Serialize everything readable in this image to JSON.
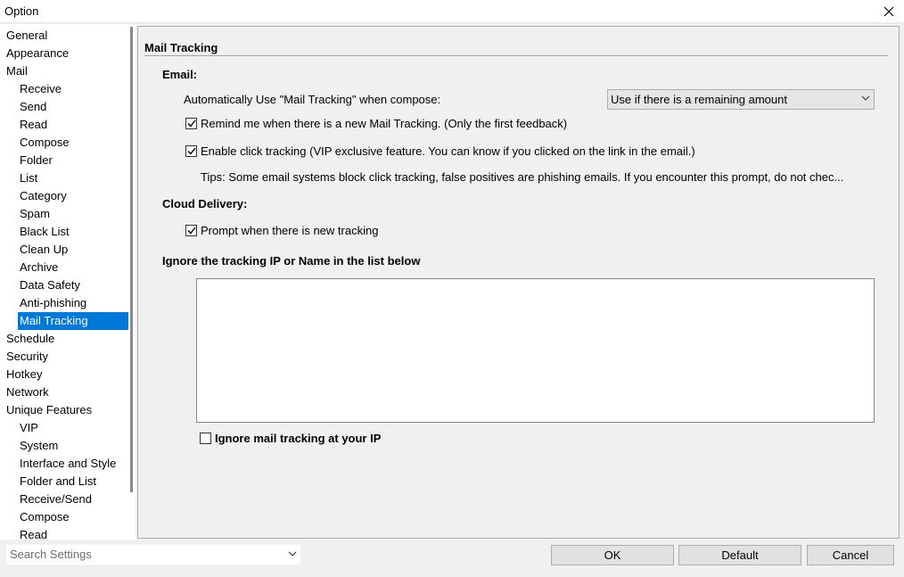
{
  "window": {
    "title": "Option"
  },
  "sidebar": {
    "items": [
      {
        "label": "General",
        "child": false
      },
      {
        "label": "Appearance",
        "child": false
      },
      {
        "label": "Mail",
        "child": false
      },
      {
        "label": "Receive",
        "child": true
      },
      {
        "label": "Send",
        "child": true
      },
      {
        "label": "Read",
        "child": true
      },
      {
        "label": "Compose",
        "child": true
      },
      {
        "label": "Folder",
        "child": true
      },
      {
        "label": "List",
        "child": true
      },
      {
        "label": "Category",
        "child": true
      },
      {
        "label": "Spam",
        "child": true
      },
      {
        "label": "Black List",
        "child": true
      },
      {
        "label": "Clean Up",
        "child": true
      },
      {
        "label": "Archive",
        "child": true
      },
      {
        "label": "Data Safety",
        "child": true
      },
      {
        "label": "Anti-phishing",
        "child": true
      },
      {
        "label": "Mail Tracking",
        "child": true,
        "selected": true
      },
      {
        "label": "Schedule",
        "child": false
      },
      {
        "label": "Security",
        "child": false
      },
      {
        "label": "Hotkey",
        "child": false
      },
      {
        "label": "Network",
        "child": false
      },
      {
        "label": "Unique Features",
        "child": false
      },
      {
        "label": "VIP",
        "child": true
      },
      {
        "label": "System",
        "child": true
      },
      {
        "label": "Interface and Style",
        "child": true
      },
      {
        "label": "Folder and List",
        "child": true
      },
      {
        "label": "Receive/Send",
        "child": true
      },
      {
        "label": "Compose",
        "child": true
      },
      {
        "label": "Read",
        "child": true
      }
    ]
  },
  "main": {
    "section_title": "Mail Tracking",
    "email_heading": "Email:",
    "auto_use_label": "Automatically Use \"Mail Tracking\" when compose:",
    "auto_use_value": "Use if there is a remaining amount",
    "remind_label": "Remind me when there is a new Mail Tracking. (Only the first feedback)",
    "remind_checked": true,
    "click_tracking_label": "Enable click tracking (VIP exclusive feature. You can know if you clicked on the link in the email.)",
    "click_tracking_checked": true,
    "tips": "Tips: Some email systems block click tracking, false positives are phishing emails. If you encounter this prompt, do not chec...",
    "cloud_heading": "Cloud Delivery:",
    "prompt_label": "Prompt when there is new tracking",
    "prompt_checked": true,
    "ignore_heading": "Ignore the tracking IP or Name  in the list below",
    "ignore_ip_label": "Ignore mail tracking at your IP",
    "ignore_ip_checked": false
  },
  "footer": {
    "search_placeholder": "Search Settings",
    "ok_label": "OK",
    "default_label": "Default",
    "cancel_label": "Cancel"
  },
  "colors": {
    "selection": "#0078d7",
    "background": "#f0f0f0"
  }
}
